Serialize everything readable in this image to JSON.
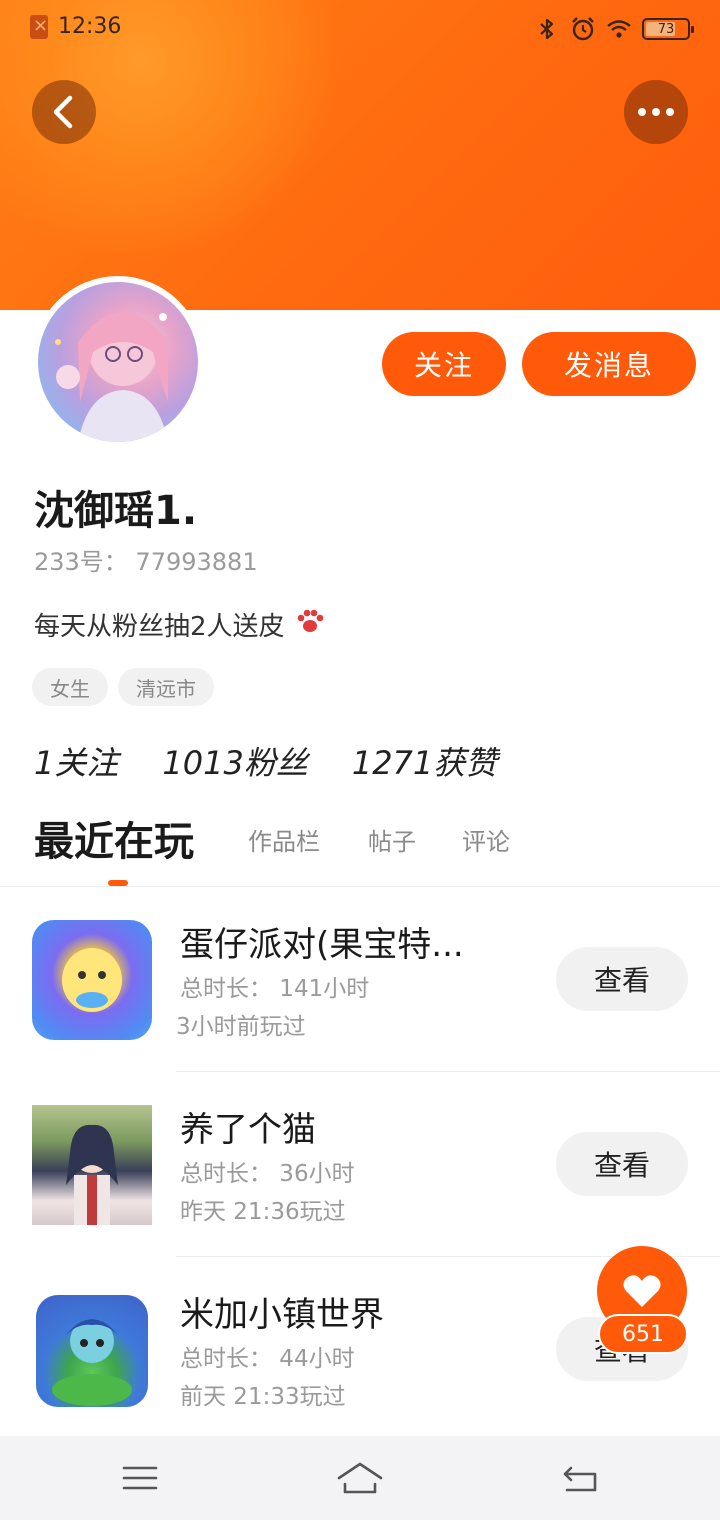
{
  "status_bar": {
    "time": "12:36",
    "battery": "73",
    "battery_level": 0.73
  },
  "profile": {
    "nickname": "沈御瑶1.",
    "account_id": "233号： 77993881",
    "bio": "每天从粉丝抽2人送皮",
    "tags": [
      "女生",
      "清远市"
    ],
    "follow_label": "关注",
    "message_label": "发消息"
  },
  "stats": [
    {
      "label": "1关注"
    },
    {
      "label": "1013粉丝"
    },
    {
      "label": "1271获赞"
    }
  ],
  "tabs": [
    "最近在玩",
    "作品栏",
    "帖子",
    "评论"
  ],
  "games": [
    {
      "title": "蛋仔派对(果宝特...",
      "duration": "总时长： 141小时",
      "last_played": "3小时前玩过",
      "button": "查看",
      "icon": "eggy-party-icon"
    },
    {
      "title": "养了个猫",
      "duration": "总时长： 36小时",
      "last_played": "昨天 21:36玩过",
      "button": "查看",
      "icon": "cat-game-icon"
    },
    {
      "title": "米加小镇世界",
      "duration": "总时长： 44小时",
      "last_played": "前天 21:33玩过",
      "button": "查看",
      "icon": "toca-town-icon"
    }
  ],
  "like_count": "651",
  "colors": {
    "accent": "#ff5a0a",
    "banner": "#ff7014"
  }
}
